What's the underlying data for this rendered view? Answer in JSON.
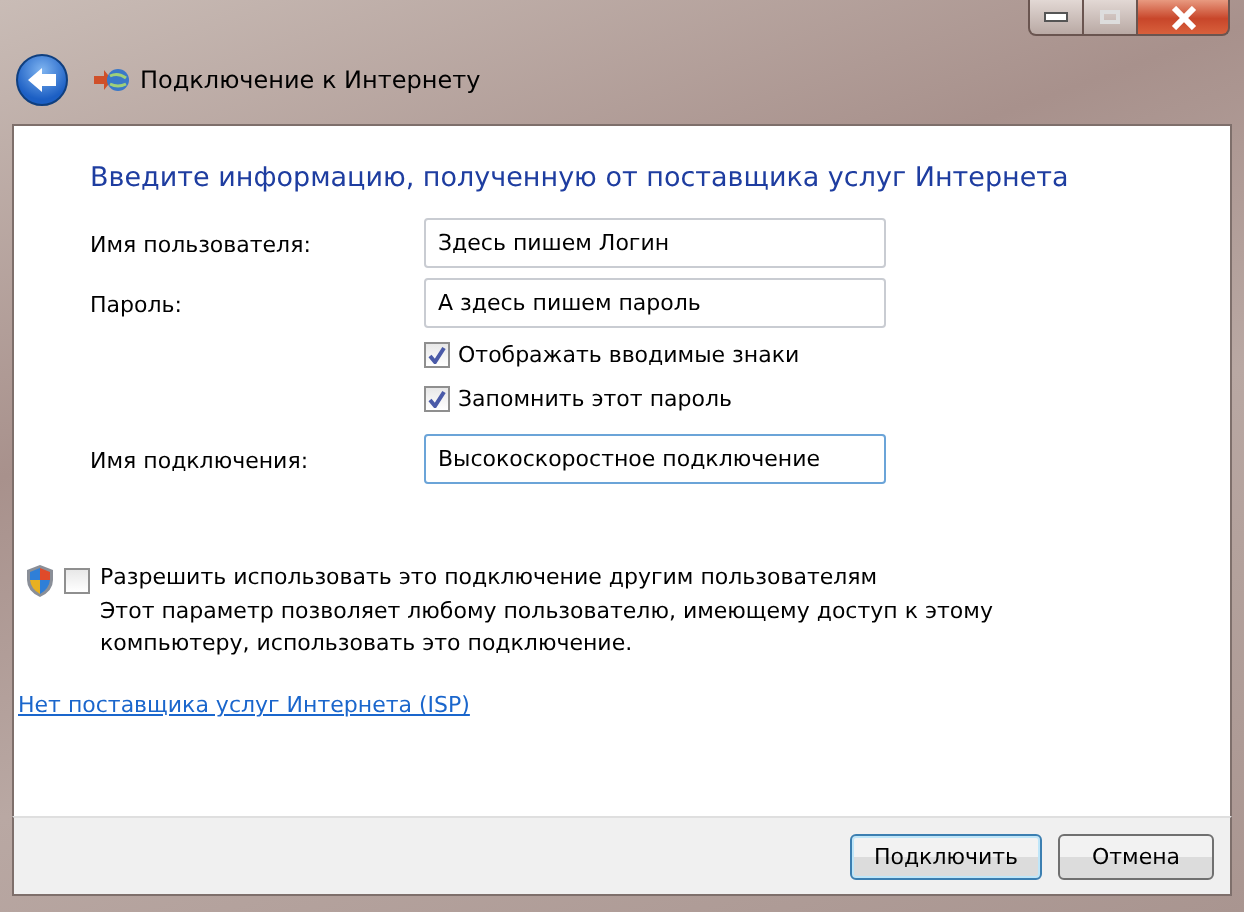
{
  "window": {
    "title": "Подключение к Интернету"
  },
  "heading": "Введите информацию, полученную от поставщика услуг Интернета",
  "fields": [
    {
      "label": "Имя пользователя:",
      "value": "Здесь пишем Логин",
      "focused": false
    },
    {
      "label": "Пароль:",
      "value": "А здесь пишем пароль",
      "focused": false
    },
    {
      "label": "Имя подключения:",
      "value": "Высокоскоростное подключение",
      "focused": true
    }
  ],
  "options": [
    {
      "label": "Отображать вводимые знаки",
      "checked": true
    },
    {
      "label": "Запомнить этот пароль",
      "checked": true
    }
  ],
  "share": {
    "label": "Разрешить использовать это подключение другим пользователям",
    "checked": false,
    "description": "Этот параметр позволяет любому пользователю, имеющему доступ к этому компьютеру, использовать это подключение."
  },
  "link": "Нет поставщика услуг Интернета (ISP)",
  "buttons": [
    {
      "label": "Подключить",
      "default": true
    },
    {
      "label": "Отмена",
      "default": false
    }
  ]
}
